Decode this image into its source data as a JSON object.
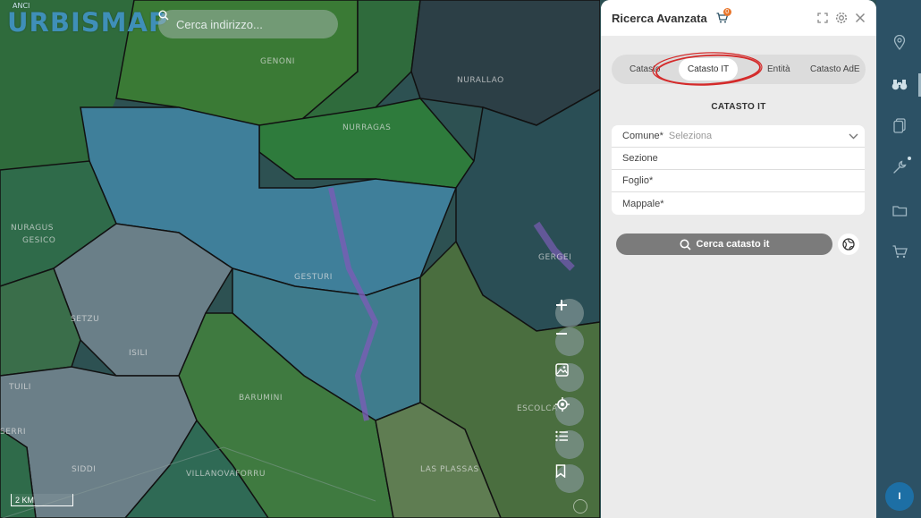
{
  "app": {
    "logo_text": "URBISMAP",
    "logo_sup": "ANCI"
  },
  "search": {
    "placeholder": "Cerca indirizzo..."
  },
  "map": {
    "place_labels": [
      "GENONI",
      "NURRAGAS",
      "NURALLAO",
      "GESTURI",
      "GERGEI",
      "SETZU",
      "ISILI",
      "TUILI",
      "GESICO",
      "SERRI",
      "BARUMINI",
      "ESCOLCA",
      "NURAGUS",
      "SIDDI",
      "VILLANOVAFORRU",
      "LAS PLASSAS"
    ],
    "scale_label": "2 KM"
  },
  "panel": {
    "title": "Ricerca Avanzata",
    "cart_badge": "0",
    "tabs": [
      "Catasto",
      "Catasto IT",
      "Entità",
      "Catasto AdE"
    ],
    "active_tab": "Catasto IT",
    "section_title": "CATASTO IT",
    "fields": {
      "comune_label": "Comune*",
      "comune_placeholder": "Seleziona",
      "sezione_label": "Sezione",
      "foglio_label": "Foglio*",
      "mappale_label": "Mappale*"
    },
    "search_button": "Cerca catasto it"
  },
  "sidebar": {
    "items": [
      "location-pin-icon",
      "binoculars-icon",
      "document-icon",
      "wrench-icon",
      "folder-icon",
      "cart-icon"
    ],
    "avatar_initial": "I"
  },
  "colors": {
    "panel_bg": "#ebebeb",
    "rail_bg": "#2c5165",
    "accent": "#1d6fa5",
    "annotation_red": "#d42a2a"
  }
}
